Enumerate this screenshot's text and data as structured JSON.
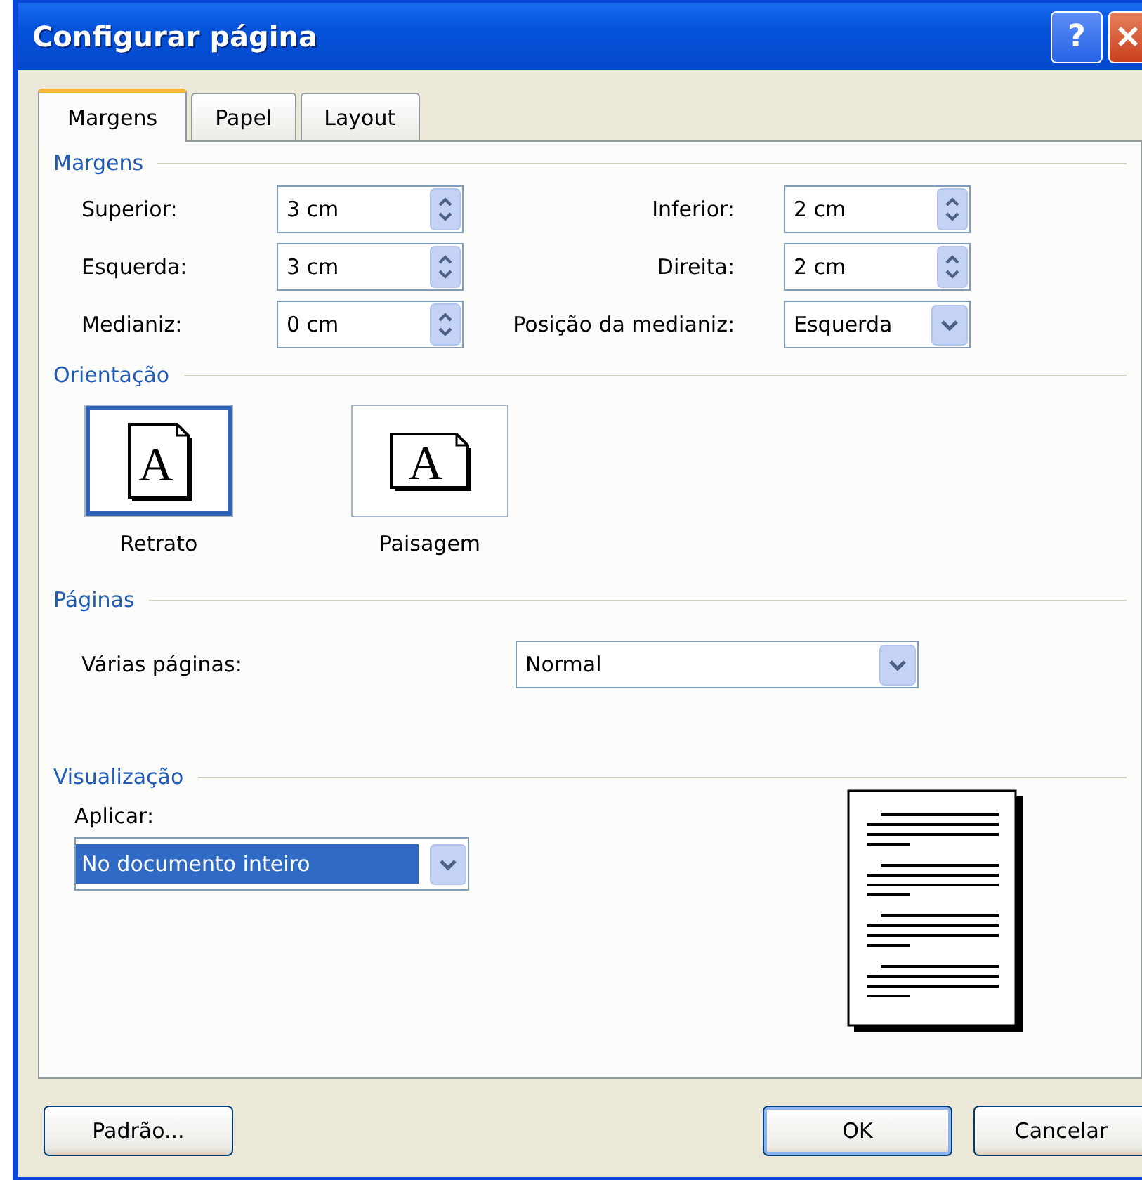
{
  "window": {
    "title": "Configurar página",
    "help_button": "?"
  },
  "tabs": [
    {
      "label": "Margens",
      "selected": true
    },
    {
      "label": "Papel",
      "selected": false
    },
    {
      "label": "Layout",
      "selected": false
    }
  ],
  "margins": {
    "heading": "Margens",
    "fields": [
      {
        "label": "Superior:",
        "value": "3 cm",
        "kind": "spinner"
      },
      {
        "label": "Inferior:",
        "value": "2 cm",
        "kind": "spinner"
      },
      {
        "label": "Esquerda:",
        "value": "3 cm",
        "kind": "spinner"
      },
      {
        "label": "Direita:",
        "value": "2 cm",
        "kind": "spinner"
      },
      {
        "label": "Medianiz:",
        "value": "0 cm",
        "kind": "spinner"
      },
      {
        "label": "Posição da medianiz:",
        "value": "Esquerda",
        "kind": "dropdown"
      }
    ]
  },
  "orientation": {
    "heading": "Orientação",
    "options": [
      {
        "label": "Retrato",
        "glyph": "A",
        "kind": "portrait",
        "selected": true
      },
      {
        "label": "Paisagem",
        "glyph": "A",
        "kind": "landscape",
        "selected": false
      }
    ]
  },
  "pages": {
    "heading": "Páginas",
    "label": "Várias páginas:",
    "value": "Normal"
  },
  "preview": {
    "heading": "Visualização",
    "label": "Aplicar:",
    "value": "No documento inteiro",
    "highlighted": true
  },
  "buttons": [
    {
      "label": "Padrão...",
      "default": false
    },
    {
      "label": "OK",
      "default": true
    },
    {
      "label": "Cancelar",
      "default": false
    }
  ]
}
